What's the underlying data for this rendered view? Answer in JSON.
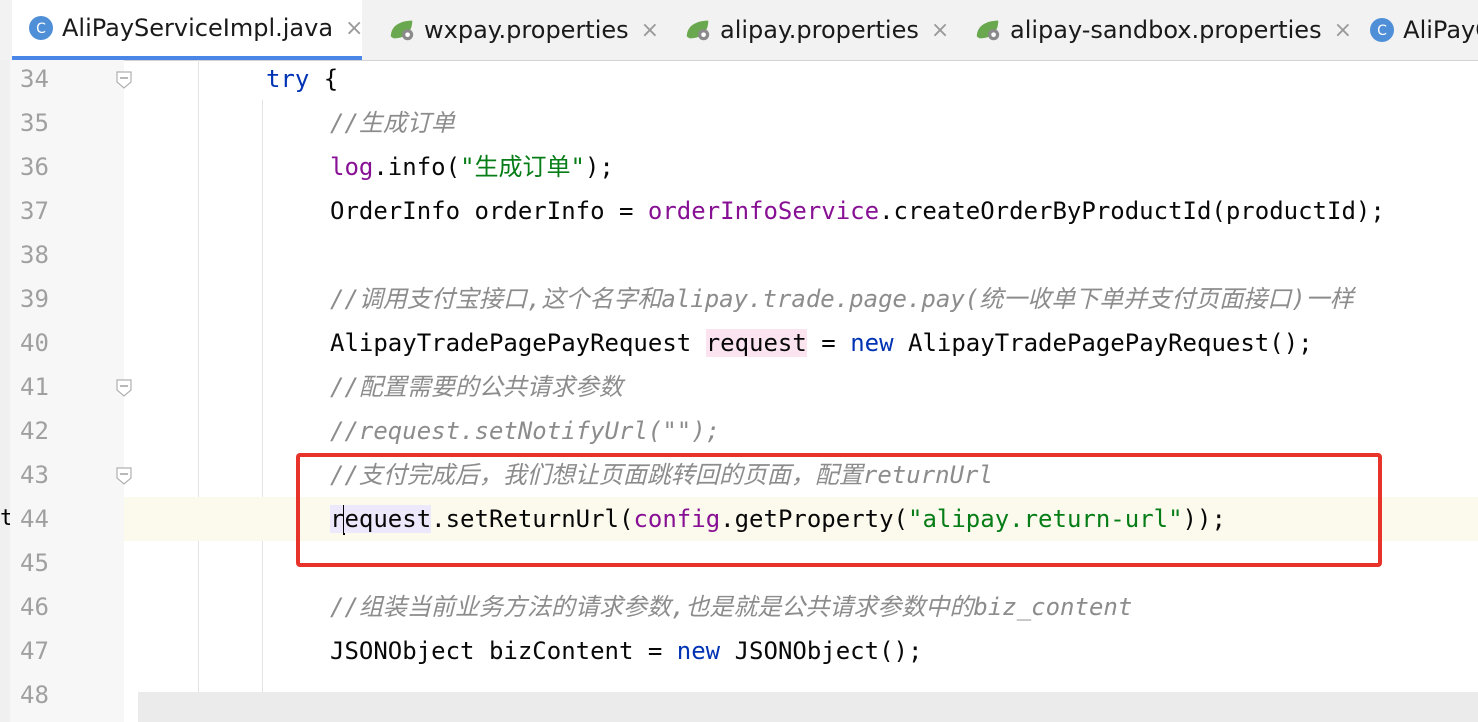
{
  "tabs": [
    {
      "label": "AliPayServiceImpl.java",
      "icon": "java-class-icon",
      "active": true
    },
    {
      "label": "wxpay.properties",
      "icon": "properties-file-icon"
    },
    {
      "label": "alipay.properties",
      "icon": "properties-file-icon"
    },
    {
      "label": "alipay-sandbox.properties",
      "icon": "properties-file-icon"
    },
    {
      "label": "AliPayC",
      "icon": "java-class-icon"
    }
  ],
  "close_glyph": "×",
  "left_marker": "t",
  "lines": [
    {
      "num": "34",
      "parts": [
        {
          "t": "try",
          "c": "kw"
        },
        {
          "t": " {"
        }
      ]
    },
    {
      "num": "35",
      "parts": [
        {
          "t": "//生成订单",
          "c": "comment"
        }
      ]
    },
    {
      "num": "36",
      "parts": [
        {
          "t": "log",
          "c": "purple"
        },
        {
          "t": ".info("
        },
        {
          "t": "\"生成订单\"",
          "c": "str"
        },
        {
          "t": ");"
        }
      ]
    },
    {
      "num": "37",
      "parts": [
        {
          "t": "OrderInfo orderInfo = "
        },
        {
          "t": "orderInfoService",
          "c": "purple"
        },
        {
          "t": ".createOrderByProductId(productId);"
        }
      ]
    },
    {
      "num": "38",
      "parts": []
    },
    {
      "num": "39",
      "parts": [
        {
          "t": "//调用支付宝接口,这个名字和alipay.trade.page.pay(统一收单下单并支付页面接口)一样",
          "c": "comment"
        }
      ]
    },
    {
      "num": "40",
      "parts": [
        {
          "t": "AlipayTradePagePayRequest "
        },
        {
          "t": "request",
          "c": "hl-pink"
        },
        {
          "t": " = "
        },
        {
          "t": "new",
          "c": "kw"
        },
        {
          "t": " AlipayTradePagePayRequest();"
        }
      ]
    },
    {
      "num": "41",
      "parts": [
        {
          "t": "//配置需要的公共请求参数",
          "c": "comment"
        }
      ]
    },
    {
      "num": "42",
      "parts": [
        {
          "t": "//request.setNotifyUrl(\"\");",
          "c": "comment"
        }
      ]
    },
    {
      "num": "43",
      "parts": [
        {
          "t": "//支付完成后，我们想让页面跳转回的页面，配置returnUrl",
          "c": "comment"
        }
      ]
    },
    {
      "num": "44",
      "parts": [
        {
          "t": "r",
          "c": "hl-ref"
        },
        {
          "t": "|caret|"
        },
        {
          "t": "equest",
          "c": "hl-ref"
        },
        {
          "t": ".setReturnUrl("
        },
        {
          "t": "config",
          "c": "purple"
        },
        {
          "t": ".getProperty("
        },
        {
          "t": "\"alipay.return-url\"",
          "c": "str"
        },
        {
          "t": "));"
        }
      ]
    },
    {
      "num": "45",
      "parts": []
    },
    {
      "num": "46",
      "parts": [
        {
          "t": "//组装当前业务方法的请求参数,也是就是公共请求参数中的biz_content",
          "c": "comment"
        }
      ]
    },
    {
      "num": "47",
      "parts": [
        {
          "t": "JSONObject bizContent = "
        },
        {
          "t": "new",
          "c": "kw"
        },
        {
          "t": " JSONObject();"
        }
      ]
    },
    {
      "num": "48",
      "parts": []
    }
  ],
  "colors": {
    "keyword": "#0033b3",
    "comment": "#8c8c8c",
    "field": "#871094",
    "string": "#067d17",
    "highlight_box": "#e8332a"
  }
}
